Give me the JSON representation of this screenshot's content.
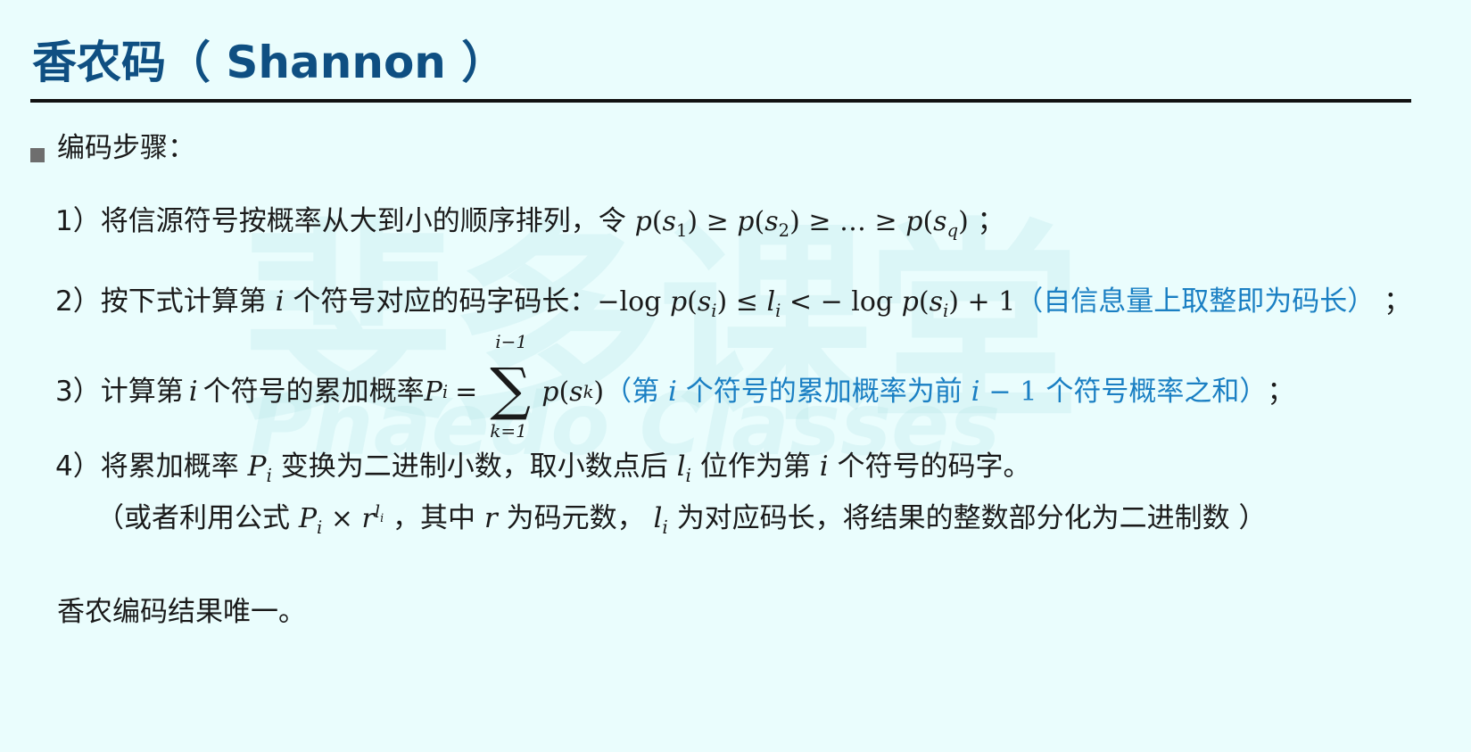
{
  "title": "香农码（ Shannon ）",
  "watermark": {
    "cn": "斐多课堂",
    "en": "Phaedo Classes"
  },
  "section": "编码步骤：",
  "step1": {
    "label": "1）将信源符号按概率从大到小的顺序排列，令",
    "p": "p",
    "s": "s",
    "sub1": "1",
    "sub2": "2",
    "subq": "q",
    "ge": "≥",
    "ellipsis": "…",
    "end": "；"
  },
  "step2": {
    "label": "2）按下式计算第",
    "i": "i",
    "label2": "个符号对应的码字码长：",
    "log": "log",
    "l": "l",
    "le": "≤",
    "lt": "<",
    "minus": "−",
    "plus": "+",
    "one": "1",
    "note": "（自信息量上取整即为码长）",
    "end": "；"
  },
  "step3": {
    "label": "3）计算第",
    "label2": "个符号的累加概率",
    "P": "P",
    "eq": "=",
    "sum_upper": "i−1",
    "sum_lower": "k=1",
    "sum_sign": "∑",
    "sk": "k",
    "note_a": "（第",
    "note_b": "个符号的累加概率为前",
    "note_c": "个符号概率之和）",
    "end": "；"
  },
  "step4": {
    "label": "4）将累加概率",
    "label2": "变换为二进制小数，取小数点后",
    "label3": "位作为第",
    "label4": "个符号的码字。",
    "alt_a": "（或者利用公式",
    "times": "×",
    "r": "r",
    "alt_b": "，其中",
    "alt_c": "为码元数，",
    "alt_d": "为对应码长，将结果的整数部分化为二进制数 ）"
  },
  "conclusion": "香农编码结果唯一。"
}
